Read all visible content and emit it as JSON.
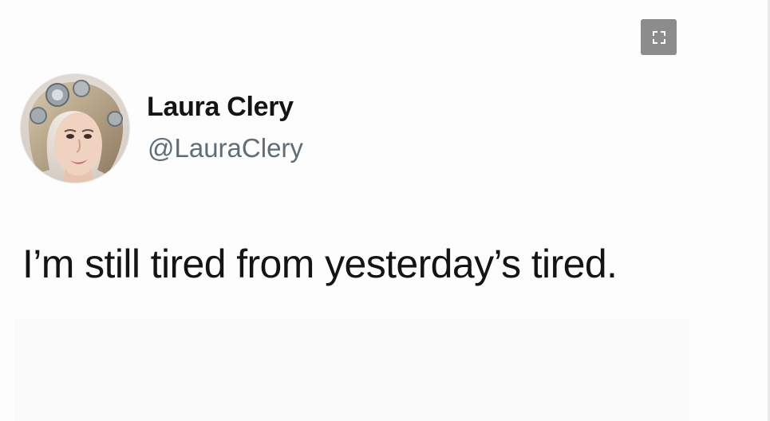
{
  "tweet": {
    "author": {
      "display_name": "Laura Clery",
      "handle": "@LauraClery",
      "avatar_icon": "profile-photo"
    },
    "text": "I’m still tired from yesterday’s tired."
  },
  "viewer": {
    "fullscreen_icon": "expand-icon",
    "fullscreen_button_color": "#8c8c8c"
  }
}
